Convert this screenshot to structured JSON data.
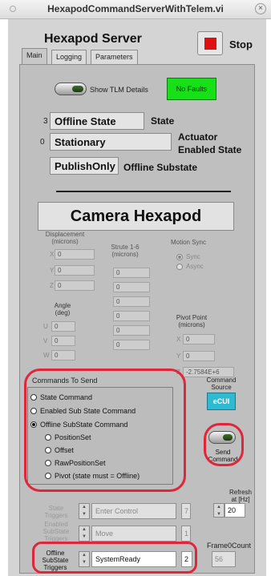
{
  "window": {
    "title": "HexapodCommandServerWithTelem.vi",
    "close_glyph": "×"
  },
  "app": {
    "title": "Hexapod Server",
    "stop_label": "Stop",
    "stop_color": "#e01010"
  },
  "tabs": [
    {
      "label": "Main",
      "active": true
    },
    {
      "label": "Logging",
      "active": false
    },
    {
      "label": "Parameters",
      "active": false
    }
  ],
  "status": {
    "show_tlm_label": "Show TLM Details",
    "faults_label": "No Faults",
    "faults_color": "#18e018",
    "state_index": "3",
    "state_value": "Offline State",
    "state_label": "State",
    "actuator_index": "0",
    "actuator_value": "Stationary",
    "actuator_label_1": "Actuator",
    "actuator_label_2": "Enabled State",
    "substate_value": "PublishOnly",
    "substate_label": "Offline Substate"
  },
  "camera_title": "Camera Hexapod",
  "displacement": {
    "title_1": "Displacement",
    "title_2": "(microns)",
    "axes": [
      {
        "label": "X",
        "value": "0"
      },
      {
        "label": "Y",
        "value": "0"
      },
      {
        "label": "Z",
        "value": "0"
      }
    ]
  },
  "angle": {
    "title_1": "Angle",
    "title_2": "(deg)",
    "axes": [
      {
        "label": "U",
        "value": "0"
      },
      {
        "label": "V",
        "value": "0"
      },
      {
        "label": "W",
        "value": "0"
      }
    ]
  },
  "struts": {
    "title_1": "Strute 1-6",
    "title_2": "(microns)",
    "values": [
      "0",
      "0",
      "0",
      "0",
      "0",
      "0"
    ]
  },
  "motion_sync": {
    "title": "Motion Sync",
    "options": [
      {
        "label": "Sync",
        "selected": true
      },
      {
        "label": "Async",
        "selected": false
      }
    ]
  },
  "pivot": {
    "title_1": "Pivot Point",
    "title_2": "(microns)",
    "axes": [
      {
        "label": "X",
        "value": "0"
      },
      {
        "label": "Y",
        "value": "0"
      },
      {
        "label": "Z",
        "value": "-2.7584E+6"
      }
    ]
  },
  "commands": {
    "title": "Commands To Send",
    "options": [
      {
        "label": "State Command",
        "selected": false
      },
      {
        "label": "Enabled Sub State Command",
        "selected": false
      },
      {
        "label": "Offline SubState Command",
        "selected": true
      }
    ],
    "sub_options": [
      {
        "label": "PositionSet",
        "selected": false
      },
      {
        "label": "Offset",
        "selected": false
      },
      {
        "label": "RawPositionSet",
        "selected": false
      },
      {
        "label": "Pivot (state must = Offline)",
        "selected": false
      }
    ]
  },
  "command_source": {
    "title_1": "Command",
    "title_2": "Source",
    "value": "eCUI",
    "color": "#2fbad2"
  },
  "send": {
    "label_1": "Send",
    "label_2": "Command"
  },
  "refresh": {
    "label_1": "Refresh",
    "label_2": "at [Hz]",
    "value": "20"
  },
  "triggers": {
    "state": {
      "label_1": "State",
      "label_2": "Triggers",
      "value": "Enter Control",
      "number": "7"
    },
    "enabled": {
      "label_1": "Enabled",
      "label_2": "SubState",
      "label_3": "Triggers",
      "value": "Move",
      "number": "1"
    },
    "offline": {
      "label_1": "Offline",
      "label_2": "SubState",
      "label_3": "Triggers",
      "value": "SystemReady",
      "number": "2"
    }
  },
  "frame_count": {
    "label": "Frame0Count",
    "value": "56"
  },
  "highlight_color": "#e0263a"
}
